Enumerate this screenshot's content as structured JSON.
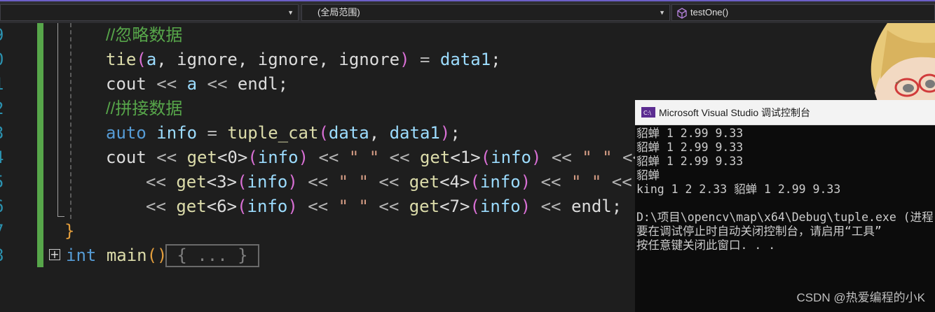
{
  "navbar": {
    "dropdown1_label": "",
    "dropdown2_label": "(全局范围)",
    "dropdown3_label": "testOne()"
  },
  "gutter": {
    "line_numbers": [
      "9",
      "0",
      "1",
      "2",
      "3",
      "4",
      "5",
      "6",
      "7",
      "8"
    ]
  },
  "code": {
    "lines": [
      [
        {
          "t": "//忽略数据",
          "c": "cm"
        }
      ],
      [
        {
          "t": "tie",
          "c": "fn"
        },
        {
          "t": "(",
          "c": "pk"
        },
        {
          "t": "a",
          "c": "vr"
        },
        {
          "t": ", ",
          "c": "pl"
        },
        {
          "t": "ignore",
          "c": "pl"
        },
        {
          "t": ", ",
          "c": "pl"
        },
        {
          "t": "ignore",
          "c": "pl"
        },
        {
          "t": ", ",
          "c": "pl"
        },
        {
          "t": "ignore",
          "c": "pl"
        },
        {
          "t": ")",
          "c": "pk"
        },
        {
          "t": " = ",
          "c": "op"
        },
        {
          "t": "data1",
          "c": "vr"
        },
        {
          "t": ";",
          "c": "pl"
        }
      ],
      [
        {
          "t": "cout",
          "c": "pl"
        },
        {
          "t": " << ",
          "c": "op"
        },
        {
          "t": "a",
          "c": "vr"
        },
        {
          "t": " << ",
          "c": "op"
        },
        {
          "t": "endl",
          "c": "pl"
        },
        {
          "t": ";",
          "c": "pl"
        }
      ],
      [
        {
          "t": "//拼接数据",
          "c": "cm"
        }
      ],
      [
        {
          "t": "auto",
          "c": "kw"
        },
        {
          "t": " ",
          "c": "pl"
        },
        {
          "t": "info",
          "c": "vr"
        },
        {
          "t": " = ",
          "c": "op"
        },
        {
          "t": "tuple_cat",
          "c": "fn"
        },
        {
          "t": "(",
          "c": "pk"
        },
        {
          "t": "data",
          "c": "vr"
        },
        {
          "t": ", ",
          "c": "pl"
        },
        {
          "t": "data1",
          "c": "vr"
        },
        {
          "t": ")",
          "c": "pk"
        },
        {
          "t": ";",
          "c": "pl"
        }
      ],
      [
        {
          "t": "cout",
          "c": "pl"
        },
        {
          "t": " << ",
          "c": "op"
        },
        {
          "t": "get",
          "c": "fn"
        },
        {
          "t": "<0>",
          "c": "pl"
        },
        {
          "t": "(",
          "c": "pk"
        },
        {
          "t": "info",
          "c": "vr"
        },
        {
          "t": ")",
          "c": "pk"
        },
        {
          "t": " << ",
          "c": "op"
        },
        {
          "t": "\" \"",
          "c": "str"
        },
        {
          "t": " << ",
          "c": "op"
        },
        {
          "t": "get",
          "c": "fn"
        },
        {
          "t": "<1>",
          "c": "pl"
        },
        {
          "t": "(",
          "c": "pk"
        },
        {
          "t": "info",
          "c": "vr"
        },
        {
          "t": ")",
          "c": "pk"
        },
        {
          "t": " << ",
          "c": "op"
        },
        {
          "t": "\" \"",
          "c": "str"
        },
        {
          "t": " <<",
          "c": "op"
        }
      ],
      [
        {
          "t": "<< ",
          "c": "op"
        },
        {
          "t": "get",
          "c": "fn"
        },
        {
          "t": "<3>",
          "c": "pl"
        },
        {
          "t": "(",
          "c": "pk"
        },
        {
          "t": "info",
          "c": "vr"
        },
        {
          "t": ")",
          "c": "pk"
        },
        {
          "t": " << ",
          "c": "op"
        },
        {
          "t": "\" \"",
          "c": "str"
        },
        {
          "t": " << ",
          "c": "op"
        },
        {
          "t": "get",
          "c": "fn"
        },
        {
          "t": "<4>",
          "c": "pl"
        },
        {
          "t": "(",
          "c": "pk"
        },
        {
          "t": "info",
          "c": "vr"
        },
        {
          "t": ")",
          "c": "pk"
        },
        {
          "t": " << ",
          "c": "op"
        },
        {
          "t": "\" \"",
          "c": "str"
        },
        {
          "t": " <<",
          "c": "op"
        }
      ],
      [
        {
          "t": "<< ",
          "c": "op"
        },
        {
          "t": "get",
          "c": "fn"
        },
        {
          "t": "<6>",
          "c": "pl"
        },
        {
          "t": "(",
          "c": "pk"
        },
        {
          "t": "info",
          "c": "vr"
        },
        {
          "t": ")",
          "c": "pk"
        },
        {
          "t": " << ",
          "c": "op"
        },
        {
          "t": "\" \"",
          "c": "str"
        },
        {
          "t": " << ",
          "c": "op"
        },
        {
          "t": "get",
          "c": "fn"
        },
        {
          "t": "<7>",
          "c": "pl"
        },
        {
          "t": "(",
          "c": "pk"
        },
        {
          "t": "info",
          "c": "vr"
        },
        {
          "t": ")",
          "c": "pk"
        },
        {
          "t": " << ",
          "c": "op"
        },
        {
          "t": "endl",
          "c": "pl"
        },
        {
          "t": ";",
          "c": "pl"
        }
      ],
      [
        {
          "t": "}",
          "c": "or"
        }
      ],
      [
        {
          "t": "int",
          "c": "kw"
        },
        {
          "t": " ",
          "c": "pl"
        },
        {
          "t": "main",
          "c": "fn"
        },
        {
          "t": "()",
          "c": "or"
        }
      ]
    ],
    "folded_text": "{ ... }"
  },
  "console": {
    "title": "Microsoft Visual Studio 调试控制台",
    "output_lines": [
      "貂蝉 1 2.99 9.33",
      "貂蝉 1 2.99 9.33",
      "貂蝉 1 2.99 9.33",
      "貂蝉",
      "king 1 2 2.33 貂蝉 1 2.99 9.33",
      "",
      "D:\\项目\\opencv\\map\\x64\\Debug\\tuple.exe (进程",
      "要在调试停止时自动关闭控制台，请启用“工具”",
      "按任意键关闭此窗口. . ."
    ]
  },
  "watermark": "CSDN @热爱编程的小K",
  "icons": {
    "cube": "cube-icon",
    "vs": "visual-studio-console-icon",
    "expand": "expand-plus-icon"
  },
  "colors": {
    "accent": "#6c5fc7",
    "change_bar": "#57a64a",
    "editor_bg": "#1e1e1e"
  }
}
